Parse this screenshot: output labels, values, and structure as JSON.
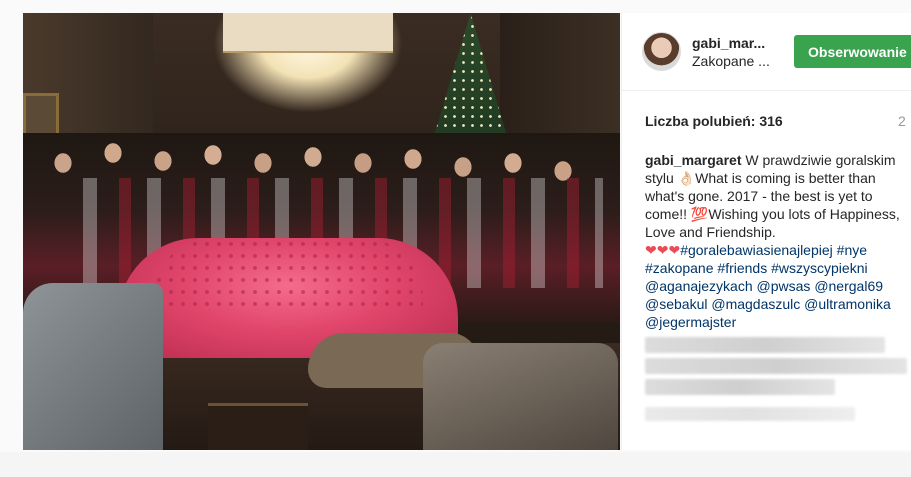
{
  "post": {
    "username": "gabi_mar...",
    "location": "Zakopane ...",
    "follow_label": "Obserwowanie",
    "likes_label": "Liczba polubień: 316",
    "time_ago": "2",
    "caption": {
      "user": "gabi_margaret",
      "text_1": " W prawdziwie goralskim stylu ",
      "emoji_1": "👌🏻",
      "text_2": "What is coming is better than what's gone. 2017 - the best is yet to come!! ",
      "emoji_2": "💯",
      "text_3": "Wishing you lots of Happiness, Love and Friendship.",
      "hearts": "❤❤❤",
      "tags": [
        "#goralebawiasienajlepiej",
        "#nye",
        "#zakopane",
        "#friends",
        "#wszyscypiekni"
      ],
      "mentions": [
        "@aganajezykach",
        "@pwsas",
        "@nergal69",
        "@sebakul",
        "@magdaszulc",
        "@ultramonika",
        "@jegermajster"
      ]
    }
  },
  "colors": {
    "follow_button": "#3aa34e",
    "link": "#003569",
    "hearts": "#ed4956"
  }
}
